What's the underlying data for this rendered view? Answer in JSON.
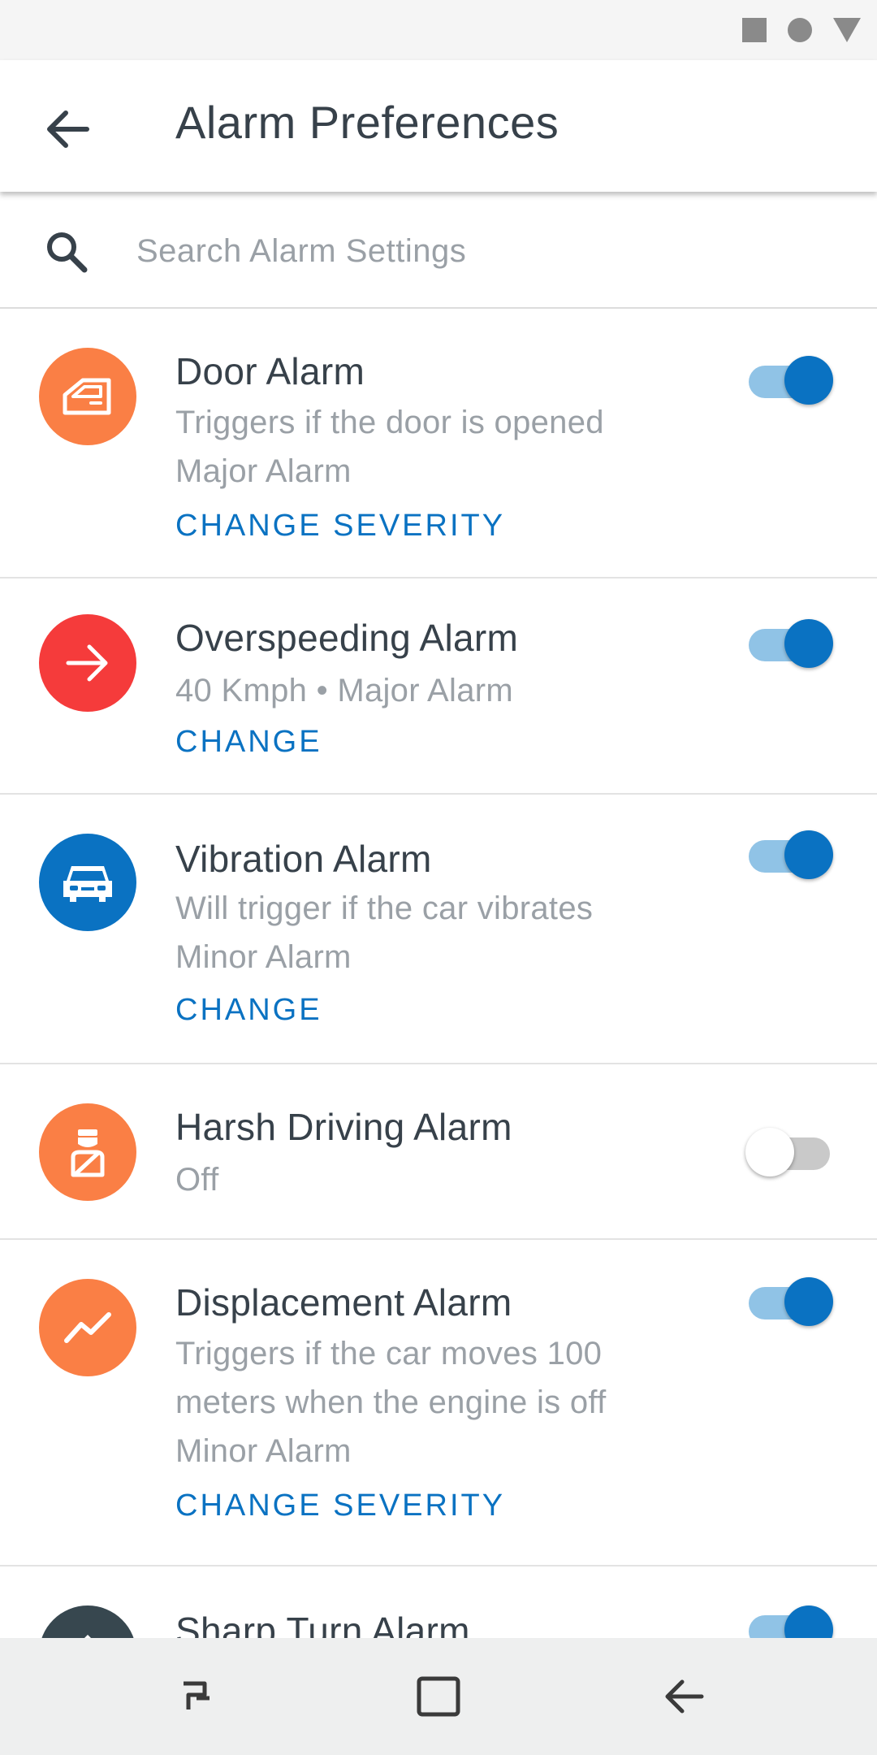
{
  "app_bar": {
    "title": "Alarm Preferences"
  },
  "search": {
    "placeholder": "Search Alarm Settings",
    "value": ""
  },
  "colors": {
    "accent": "#0a72c2",
    "orange": "#fa7f45",
    "red": "#f53b3b",
    "blue": "#0a72c2",
    "dark": "#37474f"
  },
  "alarms": [
    {
      "title": "Door Alarm",
      "line1": "Triggers if the door is opened",
      "line2": "Major Alarm",
      "action": "CHANGE SEVERITY",
      "enabled": true,
      "icon": "car-door-icon",
      "icon_color": "#fa7f45"
    },
    {
      "title": "Overspeeding Alarm",
      "line1": "40 Kmph • Major Alarm",
      "action": "CHANGE",
      "enabled": true,
      "icon": "arrow-right-icon",
      "icon_color": "#f53b3b"
    },
    {
      "title": "Vibration Alarm",
      "line1": "Will trigger if the car vibrates",
      "line2": "Minor Alarm",
      "action": "CHANGE",
      "enabled": true,
      "icon": "car-icon",
      "icon_color": "#0a72c2"
    },
    {
      "title": "Harsh Driving Alarm",
      "line1": "Off",
      "enabled": false,
      "icon": "driver-seatbelt-icon",
      "icon_color": "#fa7f45"
    },
    {
      "title": "Displacement Alarm",
      "line1": "Triggers if the car moves 100",
      "line2": "meters when the engine is off",
      "line3": "Minor Alarm",
      "action": "CHANGE SEVERITY",
      "enabled": true,
      "icon": "trend-icon",
      "icon_color": "#fa7f45"
    },
    {
      "title": "Sharp Turn Alarm",
      "enabled": true,
      "icon": "turn-icon",
      "icon_color": "#37474f"
    }
  ]
}
